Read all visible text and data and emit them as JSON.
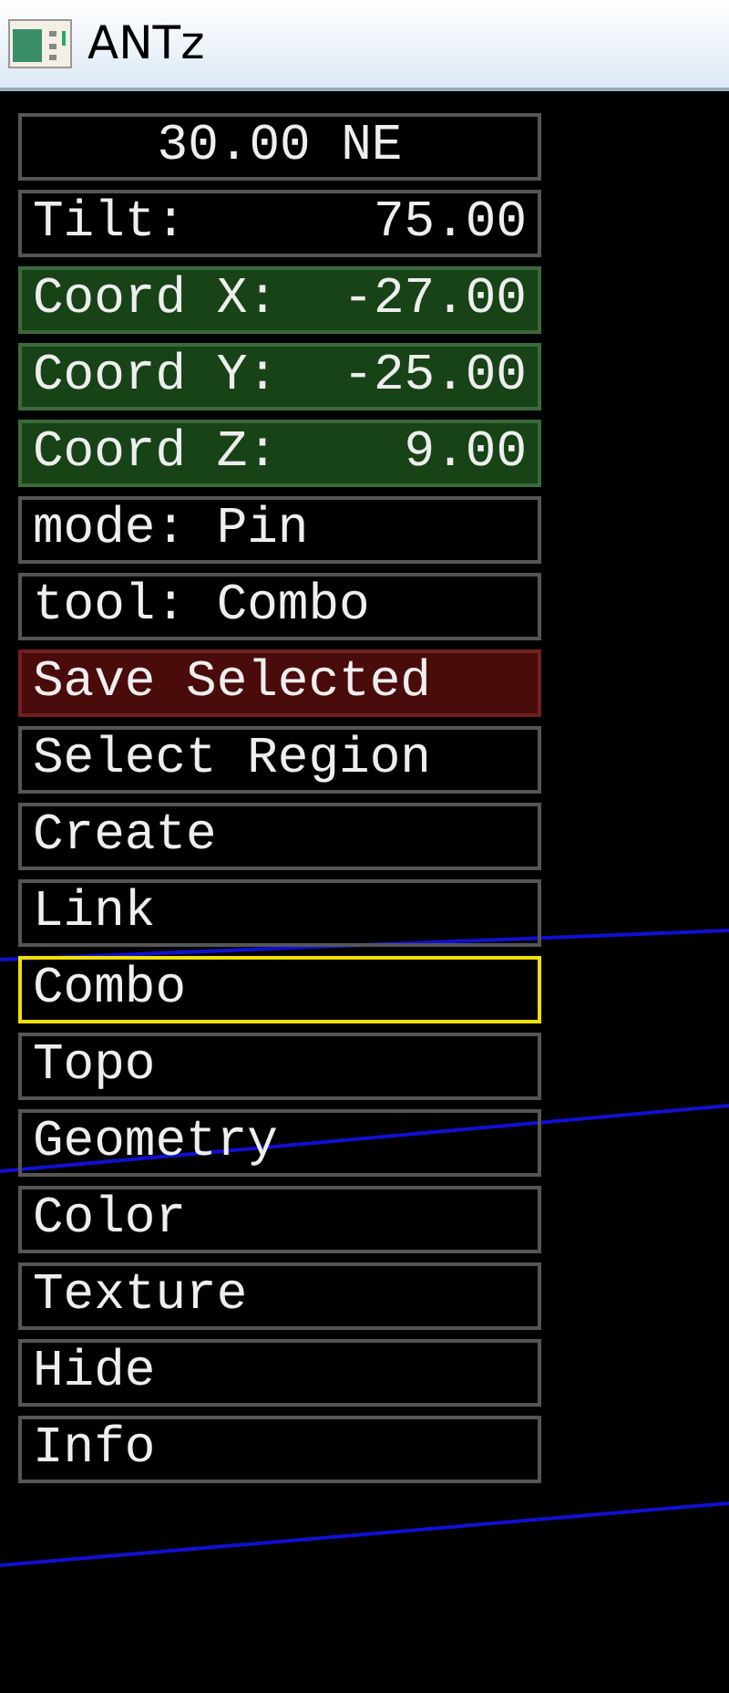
{
  "window": {
    "title": "ANTz"
  },
  "readouts": [
    {
      "kind": "heading",
      "label": "30.00 NE"
    },
    {
      "kind": "value",
      "label": "Tilt:",
      "value": "75.00"
    },
    {
      "kind": "coord",
      "label": "Coord X:",
      "value": "-27.00"
    },
    {
      "kind": "coord",
      "label": "Coord Y:",
      "value": "-25.00"
    },
    {
      "kind": "coord",
      "label": "Coord Z:",
      "value": "9.00"
    },
    {
      "kind": "text",
      "label": "mode: Pin"
    },
    {
      "kind": "text",
      "label": "tool: Combo"
    },
    {
      "kind": "save",
      "label": "Save Selected"
    },
    {
      "kind": "text",
      "label": "Select Region"
    }
  ],
  "tools": [
    {
      "label": "Create",
      "selected": false
    },
    {
      "label": "Link",
      "selected": false
    },
    {
      "label": "Combo",
      "selected": true
    },
    {
      "label": "Topo",
      "selected": false
    },
    {
      "label": "Geometry",
      "selected": false
    },
    {
      "label": "Color",
      "selected": false
    },
    {
      "label": "Texture",
      "selected": false
    },
    {
      "label": "Hide",
      "selected": false
    },
    {
      "label": "Info",
      "selected": false
    }
  ]
}
